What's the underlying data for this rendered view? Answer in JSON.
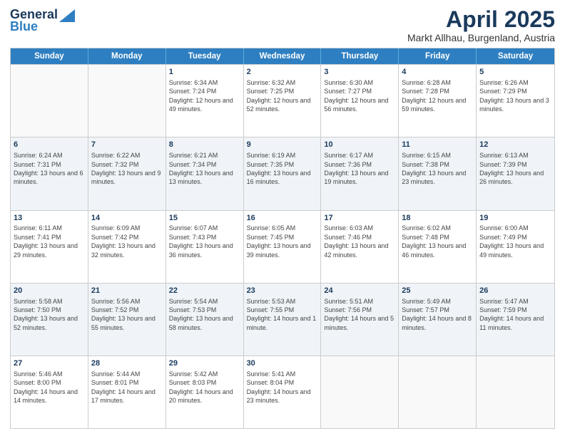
{
  "logo": {
    "general": "General",
    "blue": "Blue"
  },
  "title": {
    "month_year": "April 2025",
    "location": "Markt Allhau, Burgenland, Austria"
  },
  "weekdays": [
    "Sunday",
    "Monday",
    "Tuesday",
    "Wednesday",
    "Thursday",
    "Friday",
    "Saturday"
  ],
  "weeks": [
    [
      {
        "day": "",
        "sunrise": "",
        "sunset": "",
        "daylight": "",
        "empty": true
      },
      {
        "day": "",
        "sunrise": "",
        "sunset": "",
        "daylight": "",
        "empty": true
      },
      {
        "day": "1",
        "sunrise": "Sunrise: 6:34 AM",
        "sunset": "Sunset: 7:24 PM",
        "daylight": "Daylight: 12 hours and 49 minutes.",
        "empty": false
      },
      {
        "day": "2",
        "sunrise": "Sunrise: 6:32 AM",
        "sunset": "Sunset: 7:25 PM",
        "daylight": "Daylight: 12 hours and 52 minutes.",
        "empty": false
      },
      {
        "day": "3",
        "sunrise": "Sunrise: 6:30 AM",
        "sunset": "Sunset: 7:27 PM",
        "daylight": "Daylight: 12 hours and 56 minutes.",
        "empty": false
      },
      {
        "day": "4",
        "sunrise": "Sunrise: 6:28 AM",
        "sunset": "Sunset: 7:28 PM",
        "daylight": "Daylight: 12 hours and 59 minutes.",
        "empty": false
      },
      {
        "day": "5",
        "sunrise": "Sunrise: 6:26 AM",
        "sunset": "Sunset: 7:29 PM",
        "daylight": "Daylight: 13 hours and 3 minutes.",
        "empty": false
      }
    ],
    [
      {
        "day": "6",
        "sunrise": "Sunrise: 6:24 AM",
        "sunset": "Sunset: 7:31 PM",
        "daylight": "Daylight: 13 hours and 6 minutes.",
        "empty": false
      },
      {
        "day": "7",
        "sunrise": "Sunrise: 6:22 AM",
        "sunset": "Sunset: 7:32 PM",
        "daylight": "Daylight: 13 hours and 9 minutes.",
        "empty": false
      },
      {
        "day": "8",
        "sunrise": "Sunrise: 6:21 AM",
        "sunset": "Sunset: 7:34 PM",
        "daylight": "Daylight: 13 hours and 13 minutes.",
        "empty": false
      },
      {
        "day": "9",
        "sunrise": "Sunrise: 6:19 AM",
        "sunset": "Sunset: 7:35 PM",
        "daylight": "Daylight: 13 hours and 16 minutes.",
        "empty": false
      },
      {
        "day": "10",
        "sunrise": "Sunrise: 6:17 AM",
        "sunset": "Sunset: 7:36 PM",
        "daylight": "Daylight: 13 hours and 19 minutes.",
        "empty": false
      },
      {
        "day": "11",
        "sunrise": "Sunrise: 6:15 AM",
        "sunset": "Sunset: 7:38 PM",
        "daylight": "Daylight: 13 hours and 23 minutes.",
        "empty": false
      },
      {
        "day": "12",
        "sunrise": "Sunrise: 6:13 AM",
        "sunset": "Sunset: 7:39 PM",
        "daylight": "Daylight: 13 hours and 26 minutes.",
        "empty": false
      }
    ],
    [
      {
        "day": "13",
        "sunrise": "Sunrise: 6:11 AM",
        "sunset": "Sunset: 7:41 PM",
        "daylight": "Daylight: 13 hours and 29 minutes.",
        "empty": false
      },
      {
        "day": "14",
        "sunrise": "Sunrise: 6:09 AM",
        "sunset": "Sunset: 7:42 PM",
        "daylight": "Daylight: 13 hours and 32 minutes.",
        "empty": false
      },
      {
        "day": "15",
        "sunrise": "Sunrise: 6:07 AM",
        "sunset": "Sunset: 7:43 PM",
        "daylight": "Daylight: 13 hours and 36 minutes.",
        "empty": false
      },
      {
        "day": "16",
        "sunrise": "Sunrise: 6:05 AM",
        "sunset": "Sunset: 7:45 PM",
        "daylight": "Daylight: 13 hours and 39 minutes.",
        "empty": false
      },
      {
        "day": "17",
        "sunrise": "Sunrise: 6:03 AM",
        "sunset": "Sunset: 7:46 PM",
        "daylight": "Daylight: 13 hours and 42 minutes.",
        "empty": false
      },
      {
        "day": "18",
        "sunrise": "Sunrise: 6:02 AM",
        "sunset": "Sunset: 7:48 PM",
        "daylight": "Daylight: 13 hours and 46 minutes.",
        "empty": false
      },
      {
        "day": "19",
        "sunrise": "Sunrise: 6:00 AM",
        "sunset": "Sunset: 7:49 PM",
        "daylight": "Daylight: 13 hours and 49 minutes.",
        "empty": false
      }
    ],
    [
      {
        "day": "20",
        "sunrise": "Sunrise: 5:58 AM",
        "sunset": "Sunset: 7:50 PM",
        "daylight": "Daylight: 13 hours and 52 minutes.",
        "empty": false
      },
      {
        "day": "21",
        "sunrise": "Sunrise: 5:56 AM",
        "sunset": "Sunset: 7:52 PM",
        "daylight": "Daylight: 13 hours and 55 minutes.",
        "empty": false
      },
      {
        "day": "22",
        "sunrise": "Sunrise: 5:54 AM",
        "sunset": "Sunset: 7:53 PM",
        "daylight": "Daylight: 13 hours and 58 minutes.",
        "empty": false
      },
      {
        "day": "23",
        "sunrise": "Sunrise: 5:53 AM",
        "sunset": "Sunset: 7:55 PM",
        "daylight": "Daylight: 14 hours and 1 minute.",
        "empty": false
      },
      {
        "day": "24",
        "sunrise": "Sunrise: 5:51 AM",
        "sunset": "Sunset: 7:56 PM",
        "daylight": "Daylight: 14 hours and 5 minutes.",
        "empty": false
      },
      {
        "day": "25",
        "sunrise": "Sunrise: 5:49 AM",
        "sunset": "Sunset: 7:57 PM",
        "daylight": "Daylight: 14 hours and 8 minutes.",
        "empty": false
      },
      {
        "day": "26",
        "sunrise": "Sunrise: 5:47 AM",
        "sunset": "Sunset: 7:59 PM",
        "daylight": "Daylight: 14 hours and 11 minutes.",
        "empty": false
      }
    ],
    [
      {
        "day": "27",
        "sunrise": "Sunrise: 5:46 AM",
        "sunset": "Sunset: 8:00 PM",
        "daylight": "Daylight: 14 hours and 14 minutes.",
        "empty": false
      },
      {
        "day": "28",
        "sunrise": "Sunrise: 5:44 AM",
        "sunset": "Sunset: 8:01 PM",
        "daylight": "Daylight: 14 hours and 17 minutes.",
        "empty": false
      },
      {
        "day": "29",
        "sunrise": "Sunrise: 5:42 AM",
        "sunset": "Sunset: 8:03 PM",
        "daylight": "Daylight: 14 hours and 20 minutes.",
        "empty": false
      },
      {
        "day": "30",
        "sunrise": "Sunrise: 5:41 AM",
        "sunset": "Sunset: 8:04 PM",
        "daylight": "Daylight: 14 hours and 23 minutes.",
        "empty": false
      },
      {
        "day": "",
        "sunrise": "",
        "sunset": "",
        "daylight": "",
        "empty": true
      },
      {
        "day": "",
        "sunrise": "",
        "sunset": "",
        "daylight": "",
        "empty": true
      },
      {
        "day": "",
        "sunrise": "",
        "sunset": "",
        "daylight": "",
        "empty": true
      }
    ]
  ]
}
